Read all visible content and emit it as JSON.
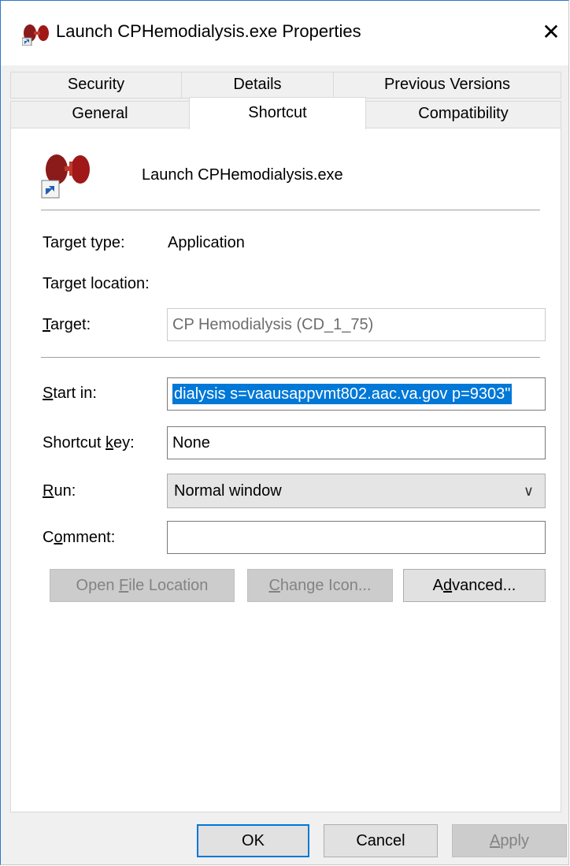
{
  "window": {
    "title": "Launch CPHemodialysis.exe Properties"
  },
  "tabs_row1": [
    {
      "label": "Security"
    },
    {
      "label": "Details"
    },
    {
      "label": "Previous Versions"
    }
  ],
  "tabs_row2": [
    {
      "label": "General"
    },
    {
      "label": "Shortcut",
      "active": true
    },
    {
      "label": "Compatibility"
    }
  ],
  "shortcut": {
    "app_name": "Launch CPHemodialysis.exe",
    "target_type_label": "Target type:",
    "target_type_value": "Application",
    "target_location_label": "Target location:",
    "target_label_pre": "",
    "target_label_u": "T",
    "target_label_post": "arget:",
    "target_value": "CP Hemodialysis (CD_1_75)",
    "start_in_label_u": "S",
    "start_in_label_post": "tart in:",
    "start_in_value": "dialysis  s=vaausappvmt802.aac.va.gov p=9303\"",
    "shortcut_key_label_pre": "Shortcut ",
    "shortcut_key_label_u": "k",
    "shortcut_key_label_post": "ey:",
    "shortcut_key_value": "None",
    "run_label_u": "R",
    "run_label_post": "un:",
    "run_value": "Normal window",
    "comment_label_pre": "C",
    "comment_label_u": "o",
    "comment_label_post": "mment:",
    "comment_value": "",
    "open_file_pre": "Open ",
    "open_file_u": "F",
    "open_file_post": "ile Location",
    "change_icon_u": "C",
    "change_icon_post": "hange Icon...",
    "advanced_pre": "A",
    "advanced_u": "d",
    "advanced_post": "vanced..."
  },
  "footer": {
    "ok": "OK",
    "cancel": "Cancel",
    "apply_u": "A",
    "apply_post": "pply"
  }
}
